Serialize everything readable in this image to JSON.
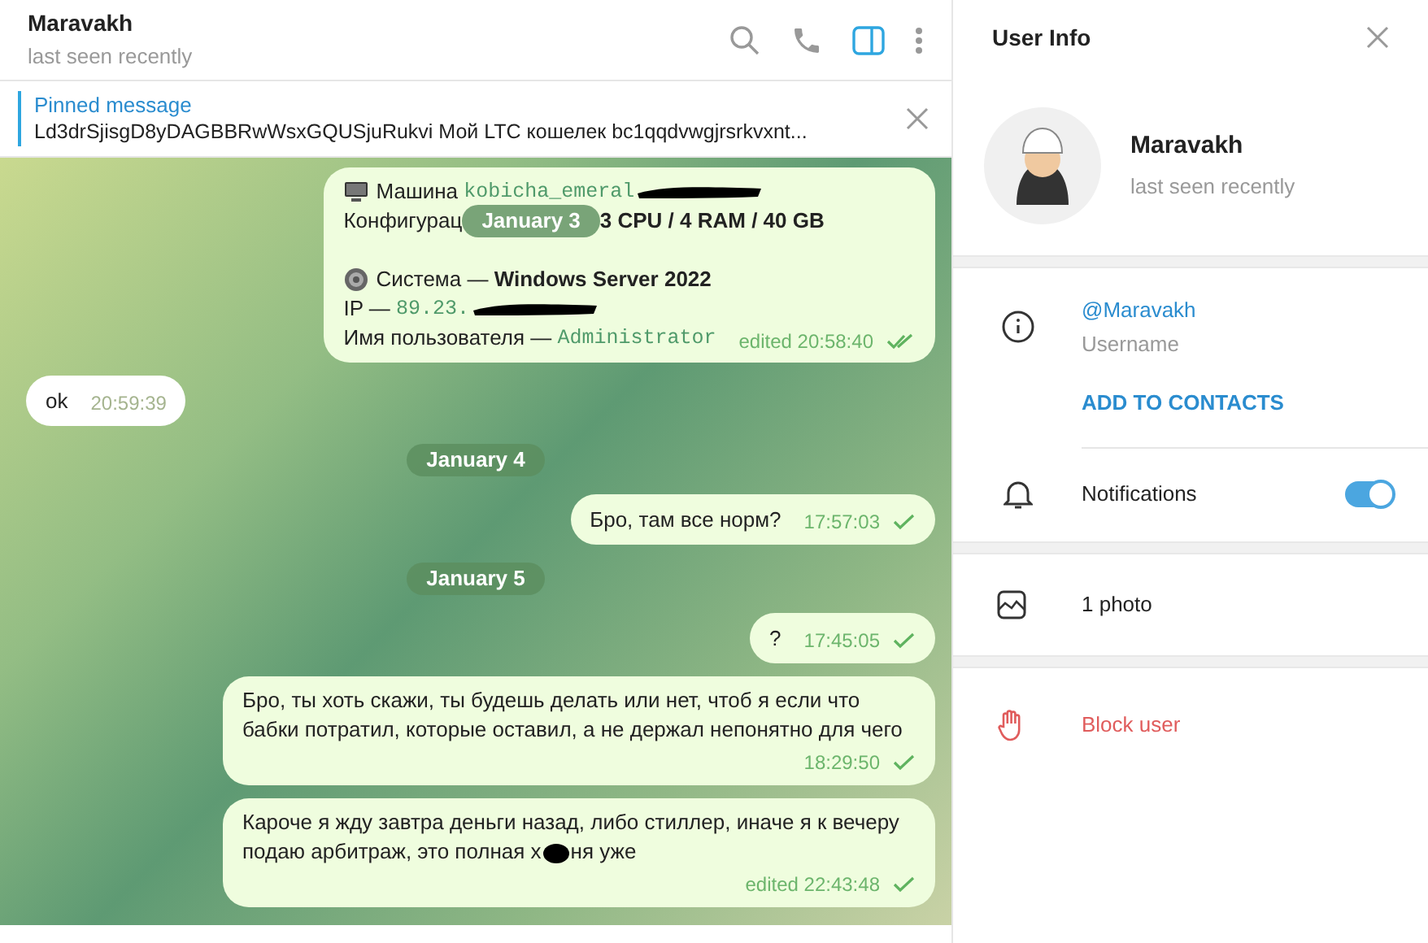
{
  "chat_header": {
    "name": "Maravakh",
    "status": "last seen recently",
    "info_panel": {
      "selected": true
    }
  },
  "pinned": {
    "label": "Pinned message",
    "text": "Ld3drSjisgD8yDAGBBRwWsxGQUSjuRukvi Мой LTC кошелек bc1qqdvwgjrsrkvxnt..."
  },
  "messages": [
    {
      "kind": "outgoing",
      "rows": [
        {
          "kind": "monitor",
          "segments": [
            {
              "kind": "plain",
              "text": "Машина "
            },
            {
              "kind": "code",
              "text": "kobicha_emeral"
            },
            {
              "kind": "redaction"
            }
          ]
        },
        {
          "kind": "text",
          "segments": [
            {
              "kind": "plain",
              "text": "Конфигурац"
            },
            {
              "kind": "date",
              "text": "January 3"
            },
            {
              "kind": "bold",
              "text": "3 CPU / 4 RAM / 40 GB"
            }
          ]
        },
        {
          "kind": "blank"
        },
        {
          "kind": "gear",
          "segments": [
            {
              "kind": "plain",
              "text": "Система — "
            },
            {
              "kind": "bold",
              "text": "Windows Server 2022"
            }
          ]
        },
        {
          "kind": "text",
          "segments": [
            {
              "kind": "plain",
              "text": "IP — "
            },
            {
              "kind": "code",
              "text": "89.23."
            },
            {
              "kind": "redaction"
            }
          ]
        },
        {
          "kind": "text",
          "segments": [
            {
              "kind": "plain",
              "text": "Имя пользователя — "
            },
            {
              "kind": "code",
              "text": "Administrator"
            }
          ]
        }
      ],
      "time": "edited 20:58:40",
      "read": true
    },
    {
      "kind": "incoming",
      "segments": [
        {
          "kind": "plain",
          "text": "ok"
        }
      ],
      "time": "20:59:39"
    },
    {
      "kind": "date",
      "text": "January 4"
    },
    {
      "kind": "outgoing",
      "segments": [
        {
          "kind": "plain",
          "text": "Бро, там все норм?"
        }
      ],
      "time": "17:57:03",
      "read": false
    },
    {
      "kind": "date",
      "text": "January 5"
    },
    {
      "kind": "outgoing",
      "segments": [
        {
          "kind": "plain",
          "text": "?"
        }
      ],
      "time": "17:45:05",
      "read": false
    },
    {
      "kind": "outgoing",
      "segments": [
        {
          "kind": "plain",
          "text": "Бро, ты хоть скажи, ты будешь делать или нет, чтоб я если что бабки потратил, которые оставил, а не держал непонятно для чего"
        }
      ],
      "time": "18:29:50",
      "read": false
    },
    {
      "kind": "outgoing",
      "segments": [
        {
          "kind": "plain",
          "text": "Кароче я жду завтра деньги назад, либо стиллер, иначе я к вечеру подаю арбитраж, это полная х"
        },
        {
          "kind": "blot"
        },
        {
          "kind": "plain",
          "text": "ня уже"
        }
      ],
      "time": "edited 22:43:48",
      "read": false
    }
  ],
  "user_info": {
    "title": "User Info",
    "name": "Maravakh",
    "status": "last seen recently",
    "username": "@Maravakh",
    "username_label": "Username",
    "add_contact": "ADD TO CONTACTS",
    "notifications": {
      "label": "Notifications",
      "on": true
    },
    "photos": "1 photo",
    "block": "Block user"
  }
}
